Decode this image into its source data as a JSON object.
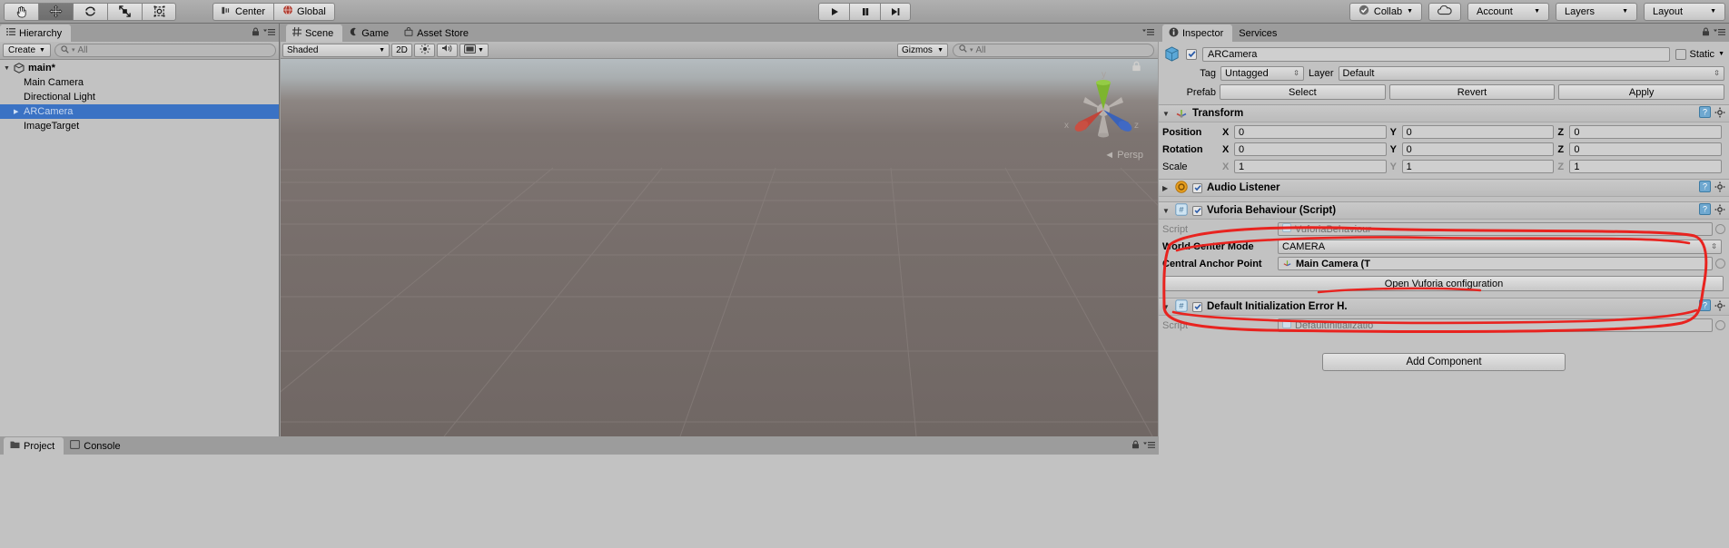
{
  "toolbar": {
    "tools": [
      {
        "name": "hand-tool",
        "active": false
      },
      {
        "name": "move-tool",
        "active": true
      },
      {
        "name": "rotate-tool",
        "active": false
      },
      {
        "name": "scale-tool",
        "active": false
      },
      {
        "name": "rect-tool",
        "active": false
      }
    ],
    "pivot_label": "Center",
    "space_label": "Global",
    "play_label": "play-button",
    "pause_label": "pause-button",
    "step_label": "step-button",
    "collab_label": "Collab",
    "cloud_label": "cloud-icon",
    "account_label": "Account",
    "layers_label": "Layers",
    "layout_label": "Layout"
  },
  "hierarchy": {
    "tab_label": "Hierarchy",
    "create_label": "Create",
    "search_placeholder": "All",
    "search_value": "All",
    "items": [
      {
        "label": "main*",
        "depth": 0,
        "type": "scene",
        "expanded": true,
        "selected": false
      },
      {
        "label": "Main Camera",
        "depth": 1,
        "type": "object",
        "expanded": false,
        "selected": false
      },
      {
        "label": "Directional Light",
        "depth": 1,
        "type": "object",
        "expanded": false,
        "selected": false
      },
      {
        "label": "ARCamera",
        "depth": 1,
        "type": "object",
        "expanded": false,
        "selected": true
      },
      {
        "label": "ImageTarget",
        "depth": 1,
        "type": "object",
        "expanded": false,
        "selected": false
      }
    ]
  },
  "scene": {
    "tabs": [
      {
        "label": "Scene",
        "icon": "grid-icon",
        "active": true
      },
      {
        "label": "Game",
        "icon": "gamepad-icon",
        "active": false
      },
      {
        "label": "Asset Store",
        "icon": "store-icon",
        "active": false
      }
    ],
    "shading_label": "Shaded",
    "mode_2d_label": "2D",
    "lighting_label": "lighting-icon",
    "audio_label": "audio-icon",
    "effects_label": "effects-icon",
    "gizmos_label": "Gizmos",
    "search_placeholder": "All",
    "search_value": "All",
    "perspective_label": "Persp",
    "gizmo_axes": [
      "x",
      "y",
      "z"
    ]
  },
  "inspector": {
    "tabs": [
      {
        "label": "Inspector",
        "active": true
      },
      {
        "label": "Services",
        "active": false
      }
    ],
    "object_enabled": true,
    "object_name": "ARCamera",
    "static_label": "Static",
    "static_checked": false,
    "tag_label": "Tag",
    "tag_value": "Untagged",
    "layer_label": "Layer",
    "layer_value": "Default",
    "prefab_label": "Prefab",
    "prefab_buttons": [
      "Select",
      "Revert",
      "Apply"
    ],
    "transform": {
      "title": "Transform",
      "rows": [
        {
          "label": "Position",
          "x": "0",
          "y": "0",
          "z": "0",
          "dim": false
        },
        {
          "label": "Rotation",
          "x": "0",
          "y": "0",
          "z": "0",
          "dim": false
        },
        {
          "label": "Scale",
          "x": "1",
          "y": "1",
          "z": "1",
          "dim": true
        }
      ]
    },
    "audio_listener": {
      "title": "Audio Listener",
      "enabled": true
    },
    "vuforia": {
      "title": "Vuforia Behaviour (Script)",
      "enabled": true,
      "script_label": "Script",
      "script_value": "VuforiaBehaviour",
      "world_center_label": "World Center Mode",
      "world_center_value": "CAMERA",
      "anchor_label": "Central Anchor Point",
      "anchor_value": "Main Camera (T",
      "config_button": "Open Vuforia configuration"
    },
    "error_handler": {
      "title": "Default Initialization Error H.",
      "enabled": true,
      "script_label": "Script",
      "script_value": "DefaultInitializatio"
    },
    "add_component_label": "Add Component"
  },
  "bottom": {
    "tabs": [
      {
        "label": "Project",
        "icon": "folder-icon",
        "active": true
      },
      {
        "label": "Console",
        "icon": "console-icon",
        "active": false
      }
    ]
  },
  "colors": {
    "selection_blue": "#3a72c4",
    "annotation_red": "#e8231f",
    "panel_gray": "#c2c2c2",
    "chrome_gray": "#9c9c9c"
  }
}
